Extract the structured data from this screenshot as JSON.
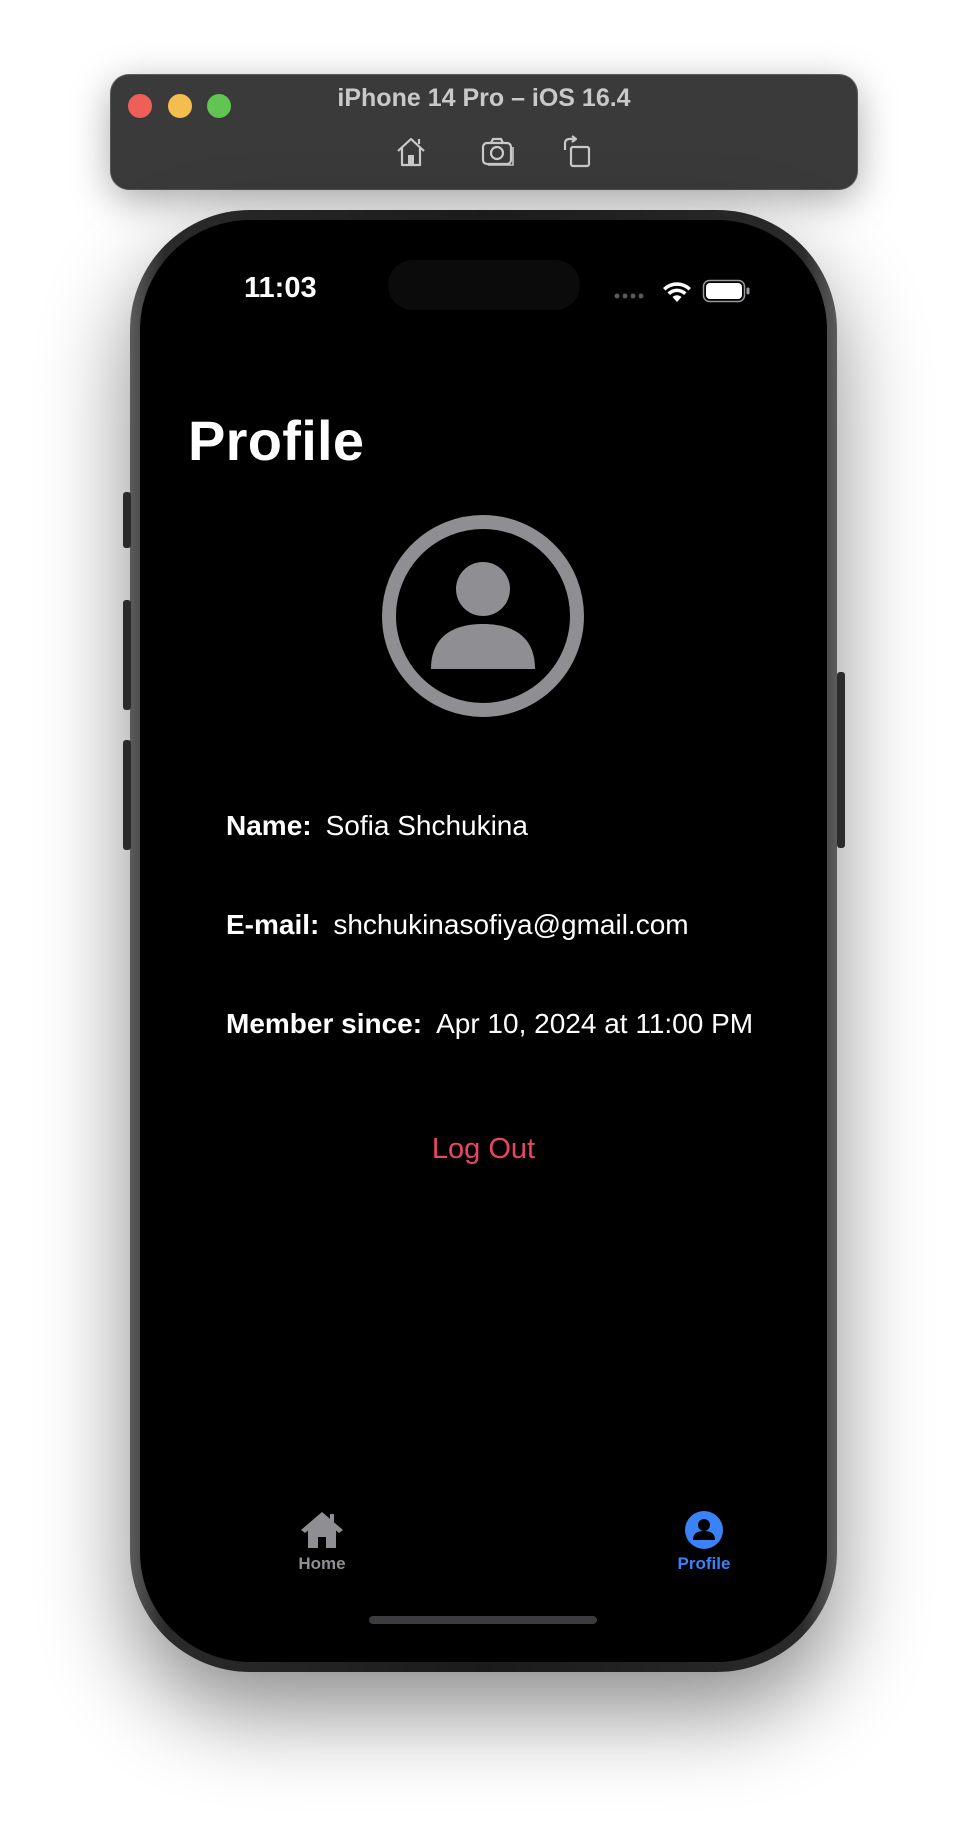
{
  "window": {
    "title": "iPhone 14 Pro – iOS 16.4",
    "toolbar_icons": [
      "home-icon",
      "screenshot-icon",
      "rotate-icon"
    ]
  },
  "status_bar": {
    "time": "11:03",
    "icons": [
      "signal-icon",
      "wifi-icon",
      "battery-icon"
    ]
  },
  "page": {
    "title": "Profile",
    "avatar_icon": "person-circle-icon"
  },
  "fields": {
    "name": {
      "label": "Name:",
      "value": "Sofia Shchukina"
    },
    "email": {
      "label": "E-mail:",
      "value": "shchukinasofiya@gmail.com"
    },
    "member_since": {
      "label": "Member since:",
      "value": "Apr 10, 2024 at 11:00 PM"
    }
  },
  "actions": {
    "logout_label": "Log Out"
  },
  "tab_bar": {
    "tabs": [
      {
        "label": "Home",
        "icon": "house-icon",
        "selected": false
      },
      {
        "label": "Profile",
        "icon": "person-circle-fill-icon",
        "selected": true
      }
    ]
  },
  "colors": {
    "accent": "#3a82f7",
    "destructive": "#e8475e",
    "inactive": "#8e8e93",
    "background": "#000000"
  }
}
